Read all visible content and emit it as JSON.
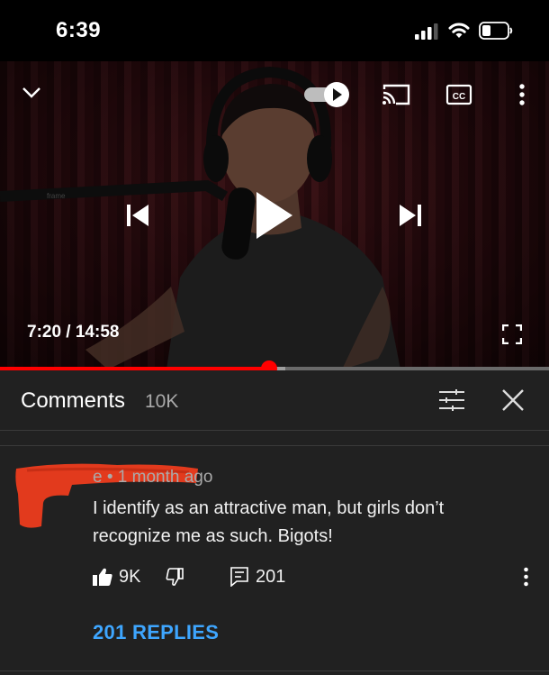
{
  "status_bar": {
    "time": "6:39",
    "icons": [
      "signal-icon",
      "wifi-icon",
      "battery-icon"
    ]
  },
  "player": {
    "current_time": "7:20",
    "duration": "14:58",
    "timecode_display": "7:20 / 14:58",
    "progress_fraction": 0.49,
    "buffered_fraction": 0.52,
    "autoplay_on": true,
    "icons": [
      "chevron-down-icon",
      "autoplay-toggle-icon",
      "cast-icon",
      "captions-icon",
      "more-vert-icon",
      "previous-icon",
      "play-icon",
      "next-icon",
      "fullscreen-icon"
    ],
    "accent_color": "#ff0000"
  },
  "comments_panel": {
    "title": "Comments",
    "count": "10K",
    "icons": [
      "filter-sliders-icon",
      "close-icon"
    ]
  },
  "comment": {
    "author_visible_fragment": "e",
    "timestamp": "• 1 month ago",
    "text": "I identify as an attractive man, but girls don’t recognize me as such. Bigots!",
    "likes": "9K",
    "reply_count": "201",
    "replies_link": "201 REPLIES",
    "icons": [
      "thumbs-up-icon",
      "thumbs-down-icon",
      "reply-icon",
      "more-vert-icon"
    ],
    "link_color": "#3ea6ff"
  }
}
